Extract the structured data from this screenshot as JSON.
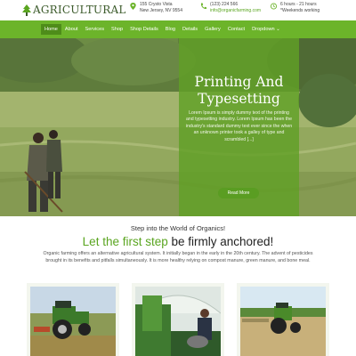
{
  "brand": {
    "name": "AGRICULTURAL",
    "icon": "tree-icon",
    "accent": "#6cb42a",
    "accent_dark": "#4e8c1a"
  },
  "contact": {
    "address": {
      "line1": "155 Crysto Vista",
      "line2": "New Jersey, NV 9554",
      "icon": "location-pin-icon"
    },
    "phone": {
      "line1": "(123) 224 566",
      "line2": "info@organicfarming.com",
      "icon": "phone-icon"
    },
    "hours": {
      "line1": "6 hours - 21 hours",
      "line2": "*Weekends working",
      "icon": "clock-icon"
    }
  },
  "nav": {
    "items": [
      {
        "label": "Home"
      },
      {
        "label": "About"
      },
      {
        "label": "Services"
      },
      {
        "label": "Shop"
      },
      {
        "label": "Shop Details"
      },
      {
        "label": "Blog"
      },
      {
        "label": "Details"
      },
      {
        "label": "Gallery"
      },
      {
        "label": "Contact"
      },
      {
        "label": "Dropdown ⌄"
      }
    ]
  },
  "hero": {
    "title_line1": "Printing And",
    "title_line2": "Typesetting",
    "text": "Lorem Ipsum is simply dummy text of the printing and typesetting industry. Lorem Ipsum has been the industry's standard dummy text ever since the when an unknown printer took a galley of type and scrambled [...]",
    "button": "Read More"
  },
  "intro": {
    "subtitle": "Step into the World of Organics!",
    "title_green": "Let the first step",
    "title_dark": "be firmly anchored!",
    "text": "Organic farming offers an alternative agricultural system. It initially began in the early in the 20th century. The advent of pesticides brought in its benefits and pitfalls simultaneously. It is more healthy relying on compost manure, green manure, and bone meal."
  },
  "cards": [
    {
      "image": "tractor-field-photo"
    },
    {
      "image": "greenhouse-photo"
    },
    {
      "image": "tractor-farm-photo"
    }
  ]
}
